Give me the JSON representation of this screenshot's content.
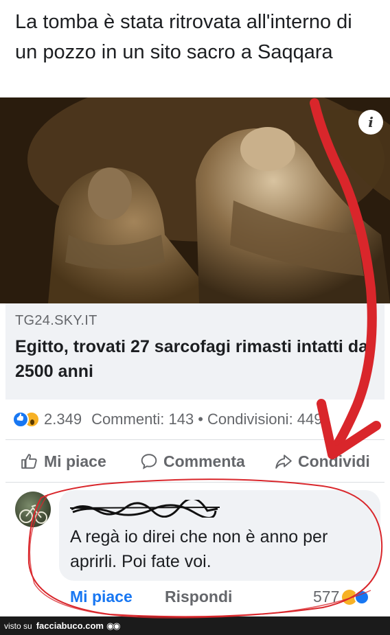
{
  "post": {
    "text": "La tomba è stata ritrovata all'interno di un pozzo in un sito sacro a Saqqara"
  },
  "link": {
    "source": "TG24.SKY.IT",
    "title": "Egitto, trovati 27 sarcofagi rimasti intatti da 2500 anni",
    "info_icon": "info-icon"
  },
  "stats": {
    "reactions": "2.349",
    "comments_label": "Commenti: 143",
    "separator": "•",
    "shares_label": "Condivisioni: 449"
  },
  "actions": {
    "like": "Mi piace",
    "comment": "Commenta",
    "share": "Condividi"
  },
  "comment": {
    "text": "A regà io direi che non è anno per aprirli. Poi fate voi.",
    "like": "Mi piace",
    "reply": "Rispondi",
    "count": "577"
  },
  "footer": {
    "prefix": "visto su",
    "site": "facciabuco.com"
  },
  "colors": {
    "facebook_blue": "#1877f2",
    "annotation_red": "#d9262b",
    "gray_text": "#65676b"
  }
}
